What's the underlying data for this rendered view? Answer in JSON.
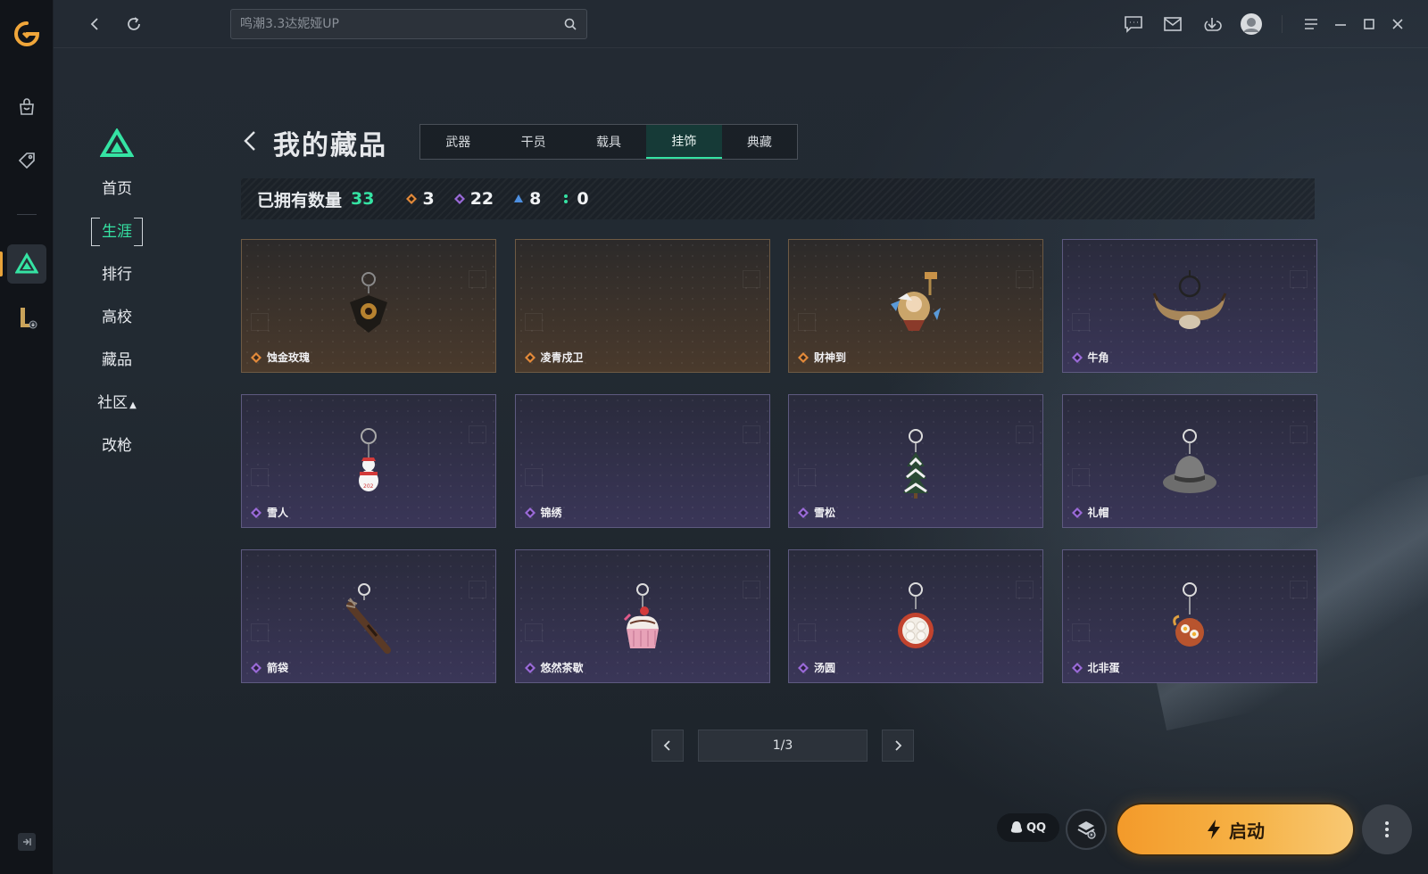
{
  "search": {
    "placeholder": "鸣潮3.3达妮娅UP"
  },
  "game_nav": {
    "items": [
      {
        "label": "首页",
        "active": false
      },
      {
        "label": "生涯",
        "active": true
      },
      {
        "label": "排行",
        "active": false
      },
      {
        "label": "高校",
        "active": false
      },
      {
        "label": "藏品",
        "active": false
      },
      {
        "label": "社区",
        "active": false
      },
      {
        "label": "改枪",
        "active": false
      }
    ]
  },
  "page": {
    "title": "我的藏品"
  },
  "tabs": [
    {
      "label": "武器",
      "active": false
    },
    {
      "label": "干员",
      "active": false
    },
    {
      "label": "载具",
      "active": false
    },
    {
      "label": "挂饰",
      "active": true
    },
    {
      "label": "典藏",
      "active": false
    }
  ],
  "stats": {
    "label": "已拥有数量",
    "total": "33",
    "counts": [
      {
        "rarity": "gold",
        "color": "#e38a3a",
        "value": "3"
      },
      {
        "rarity": "purple",
        "color": "#9a6ad8",
        "value": "22"
      },
      {
        "rarity": "blue",
        "color": "#4d8fe0",
        "value": "8"
      },
      {
        "rarity": "green",
        "color": "#35e3a3",
        "value": "0"
      }
    ]
  },
  "items": [
    {
      "name": "蚀金玫瑰",
      "rarity": "gold",
      "art": "rose-pendant"
    },
    {
      "name": "凌青戍卫",
      "rarity": "gold",
      "art": "none"
    },
    {
      "name": "财神到",
      "rarity": "gold",
      "art": "fortune-god"
    },
    {
      "name": "牛角",
      "rarity": "purple",
      "art": "horns"
    },
    {
      "name": "雪人",
      "rarity": "purple",
      "art": "snowman"
    },
    {
      "name": "锦绣",
      "rarity": "purple",
      "art": "none"
    },
    {
      "name": "雪松",
      "rarity": "purple",
      "art": "pine"
    },
    {
      "name": "礼帽",
      "rarity": "purple",
      "art": "hat"
    },
    {
      "name": "箭袋",
      "rarity": "purple",
      "art": "quiver"
    },
    {
      "name": "悠然茶歇",
      "rarity": "purple",
      "art": "cupcake"
    },
    {
      "name": "汤圆",
      "rarity": "purple",
      "art": "tangyuan"
    },
    {
      "name": "北非蛋",
      "rarity": "purple",
      "art": "shakshuka"
    }
  ],
  "pagination": {
    "display": "1/3"
  },
  "launch": {
    "qq_label": "QQ",
    "button_label": "启动"
  },
  "colors": {
    "accent_green": "#35e3a3",
    "gold": "#e38a3a",
    "purple": "#9a6ad8",
    "launch": "#f6b246"
  }
}
